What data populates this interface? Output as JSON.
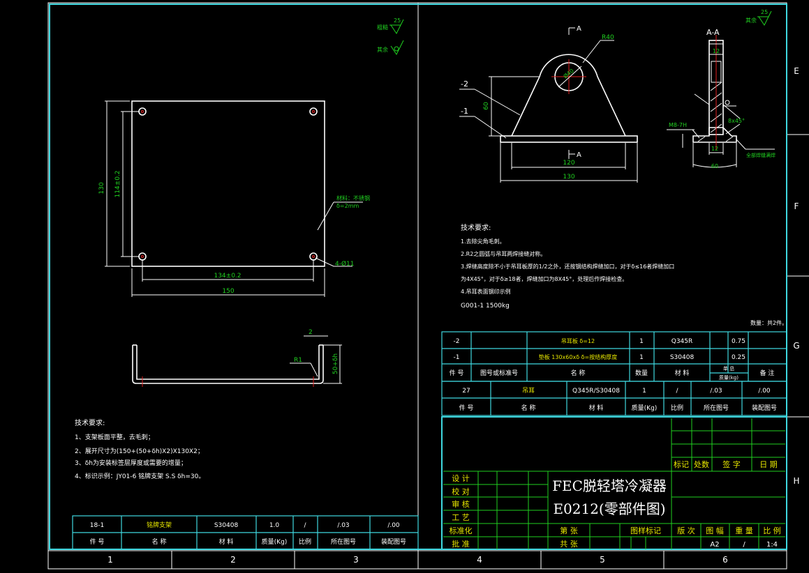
{
  "ruler": {
    "rows": [
      "E",
      "F",
      "G",
      "H"
    ],
    "cols": [
      "1",
      "2",
      "3",
      "4",
      "5",
      "6"
    ]
  },
  "left": {
    "rough1_label": "粗糙",
    "rough1_val": "25",
    "rough2_label": "其余",
    "dim_130": "130",
    "dim_114": "114±0.2",
    "dim_134": "134±0.2",
    "dim_150": "150",
    "material_note_1": "材料：不锈钢",
    "material_note_2": "δ=2mm",
    "hole_note": "4-Ø11",
    "dim_2": "2",
    "dim_r1": "R1",
    "dim_50": "50+δh",
    "tech_title": "技术要求:",
    "tech": [
      "1、支架板面平整，去毛刺；",
      "2、展开尺寸为(150+(50+δh)X2)X130X2；",
      "3、δh为安装标签层厚度或需要的增量；",
      "4、标识示例：JY01-6 铭牌支架 S.S δh=30。"
    ],
    "part_row": [
      "18-1",
      "铭牌支架",
      "S30408",
      "1.0",
      "/",
      "/.03",
      "/.00"
    ],
    "part_head": [
      "件  号",
      "名   称",
      "材  料",
      "质量(Kg)",
      "比例",
      "所在图号",
      "装配图号"
    ]
  },
  "right": {
    "rough_label": "其余",
    "rough_val": "25",
    "sec_a": "A",
    "sec_aa": "A-A",
    "dim_r40": "R40",
    "dim_d40": "Ø40",
    "lead_2": "-2",
    "lead_1": "-1",
    "dim_60v": "60",
    "dim_120": "120",
    "dim_130": "130",
    "dim_12a": "12",
    "dim_12b": "12",
    "dim_60h": "60",
    "dim_m8": "M8-7H",
    "dim_8x45": "8x45°",
    "weld_note": "全部焊缝满焊",
    "tech_title": "技术要求:",
    "tech": [
      "1.去除尖角毛刺。",
      "2.R2之圆弧与吊耳两焊接缝对称。",
      "3.焊缝高度除不小于吊耳板厚的1/2之外，还按钢结构焊缝加口，对于δ≤16者焊缝加口",
      "  为4X45°，对于δ≥18者，焊缝加口为8X45°，处理后作焊接检查。",
      "4.吊耳表面钢印示例",
      "  G001-1  1500kg"
    ],
    "qty_note": "数量：共2件。",
    "bom": [
      [
        "-2",
        "",
        "吊耳板  δ=12",
        "1",
        "Q345R",
        "",
        "0.75",
        ""
      ],
      [
        "-1",
        "",
        "垫板   130x60xδ  δ=按结构厚度",
        "1",
        "S30408",
        "",
        "0.25",
        ""
      ]
    ],
    "bom_head": [
      "件 号",
      "图号或标准号",
      "名    称",
      "数量",
      "材  料",
      "单  总",
      "质量(kg)",
      "备  注"
    ],
    "part_row": [
      "27",
      "吊耳",
      "Q345R/S30408",
      "1",
      "/",
      "/.03",
      "/.00"
    ],
    "part_head": [
      "件  号",
      "名   称",
      "材   料",
      "质量(Kg)",
      "比例",
      "所在图号",
      "装配图号"
    ]
  },
  "title_block": {
    "rev_head": [
      "标记",
      "处数",
      "签  字",
      "日  期"
    ],
    "roles": [
      "设  计",
      "校  对",
      "审  核",
      "工  艺",
      "标准化",
      "批  准"
    ],
    "title_1": "FEC脱轻塔冷凝器",
    "title_2": "E0212(零部件图)",
    "sheet_lbl": "第    张",
    "total_lbl": "共    张",
    "mark_lbl": "图样标记",
    "ver_lbl": "版 次",
    "fmt_lbl": "图 幅",
    "wt_lbl": "重  量",
    "scale_lbl": "比  例",
    "fmt_val": "A2",
    "wt_val": "/",
    "scale_val": "1:4"
  }
}
